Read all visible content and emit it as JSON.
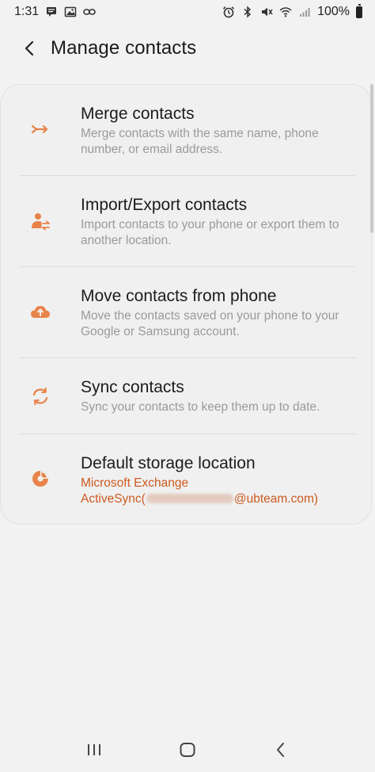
{
  "status_bar": {
    "time": "1:31",
    "battery": "100%"
  },
  "header": {
    "title": "Manage contacts"
  },
  "accent_color": "#e8844a",
  "items": [
    {
      "title": "Merge contacts",
      "description": "Merge contacts with the same name, phone number, or email address.",
      "icon": "merge-icon"
    },
    {
      "title": "Import/Export contacts",
      "description": "Import contacts to your phone or export them to another location.",
      "icon": "person-transfer-icon"
    },
    {
      "title": "Move contacts from phone",
      "description": "Move the contacts saved on your phone to your Google or Samsung account.",
      "icon": "cloud-upload-icon"
    },
    {
      "title": "Sync contacts",
      "description": "Sync your contacts to keep them up to date.",
      "icon": "sync-icon"
    },
    {
      "title": "Default storage location",
      "description_line1": "Microsoft Exchange",
      "description_line2_prefix": "ActiveSync(",
      "description_line2_suffix": "@ubteam.com)",
      "icon": "storage-pie-icon"
    }
  ],
  "nav": {
    "recents": "recents-icon",
    "home": "home-icon",
    "back": "back-icon"
  }
}
